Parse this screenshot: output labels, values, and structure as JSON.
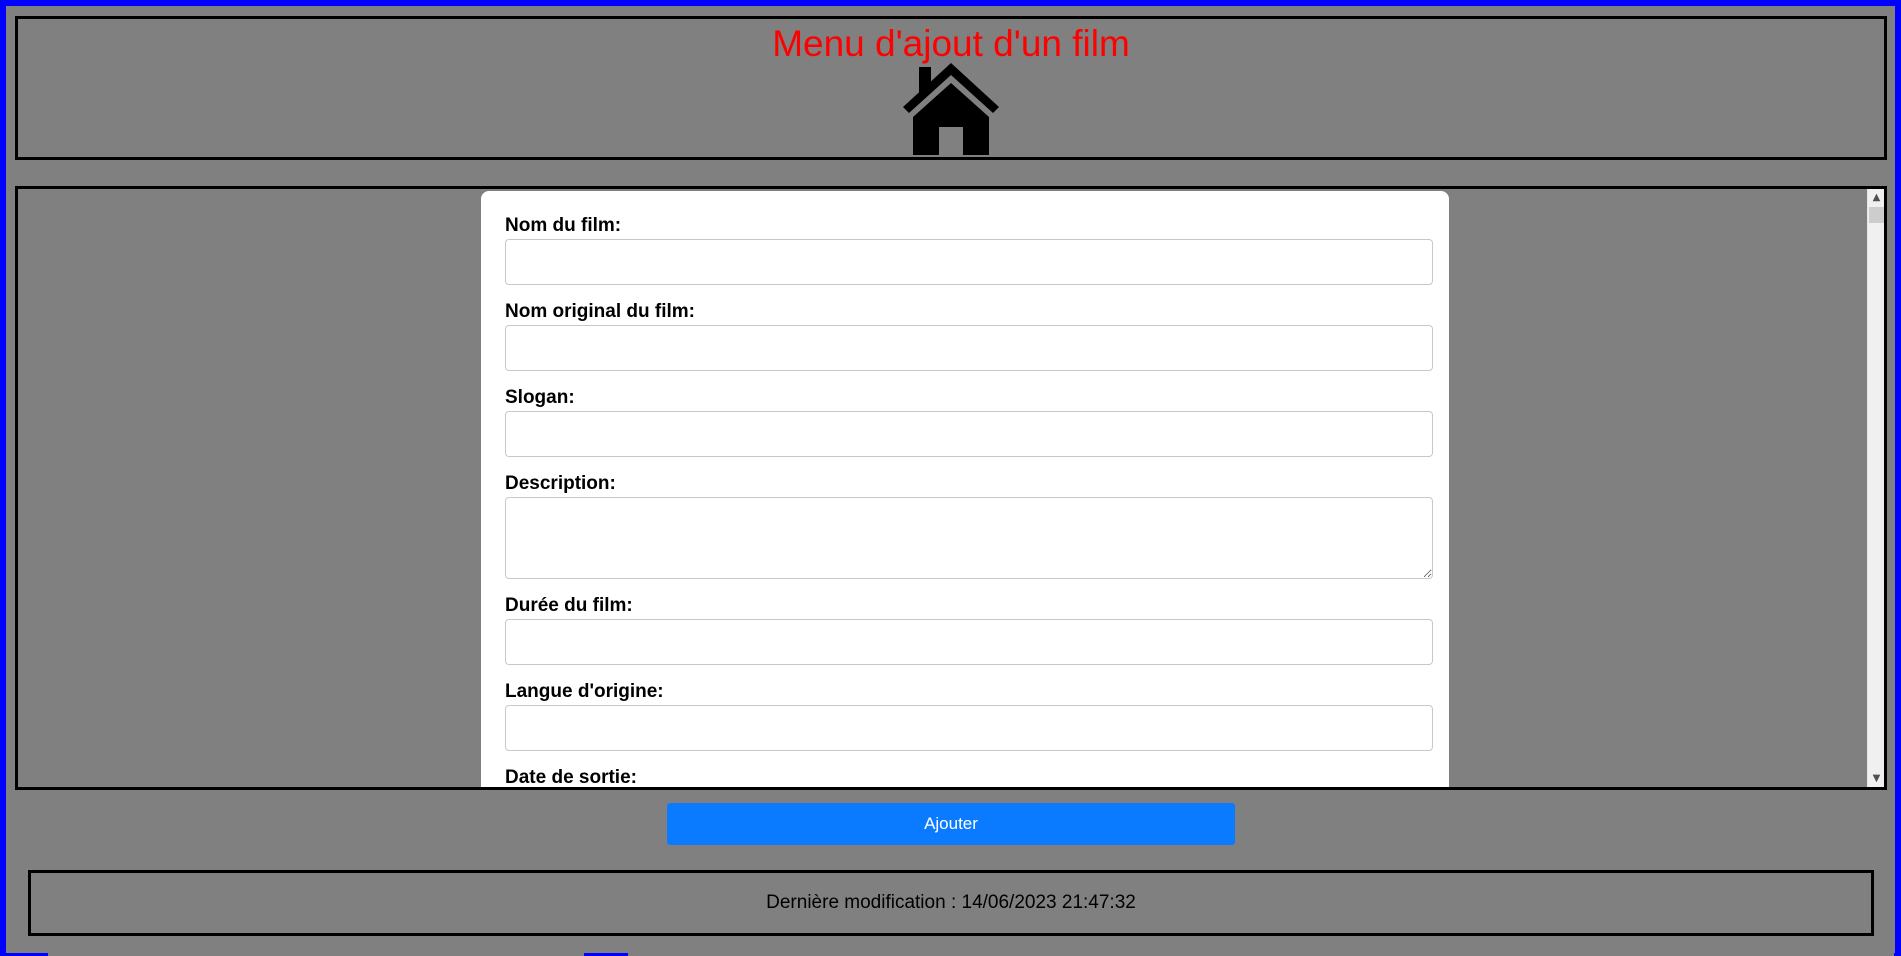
{
  "header": {
    "title": "Menu d'ajout d'un film",
    "home_icon": "home-icon"
  },
  "form": {
    "fields": [
      {
        "label": "Nom du film:",
        "value": ""
      },
      {
        "label": "Nom original du film:",
        "value": ""
      },
      {
        "label": "Slogan:",
        "value": ""
      },
      {
        "label": "Description:",
        "value": ""
      },
      {
        "label": "Durée du film:",
        "value": ""
      },
      {
        "label": "Langue d'origine:",
        "value": ""
      },
      {
        "label": "Date de sortie:",
        "value": ""
      }
    ],
    "submit_label": "Ajouter"
  },
  "footer": {
    "last_modified": "Dernière modification : 14/06/2023 21:47:32"
  },
  "colors": {
    "background": "#808080",
    "page_border": "#0000ff",
    "title": "#ff0000",
    "button": "#0a7bff"
  }
}
